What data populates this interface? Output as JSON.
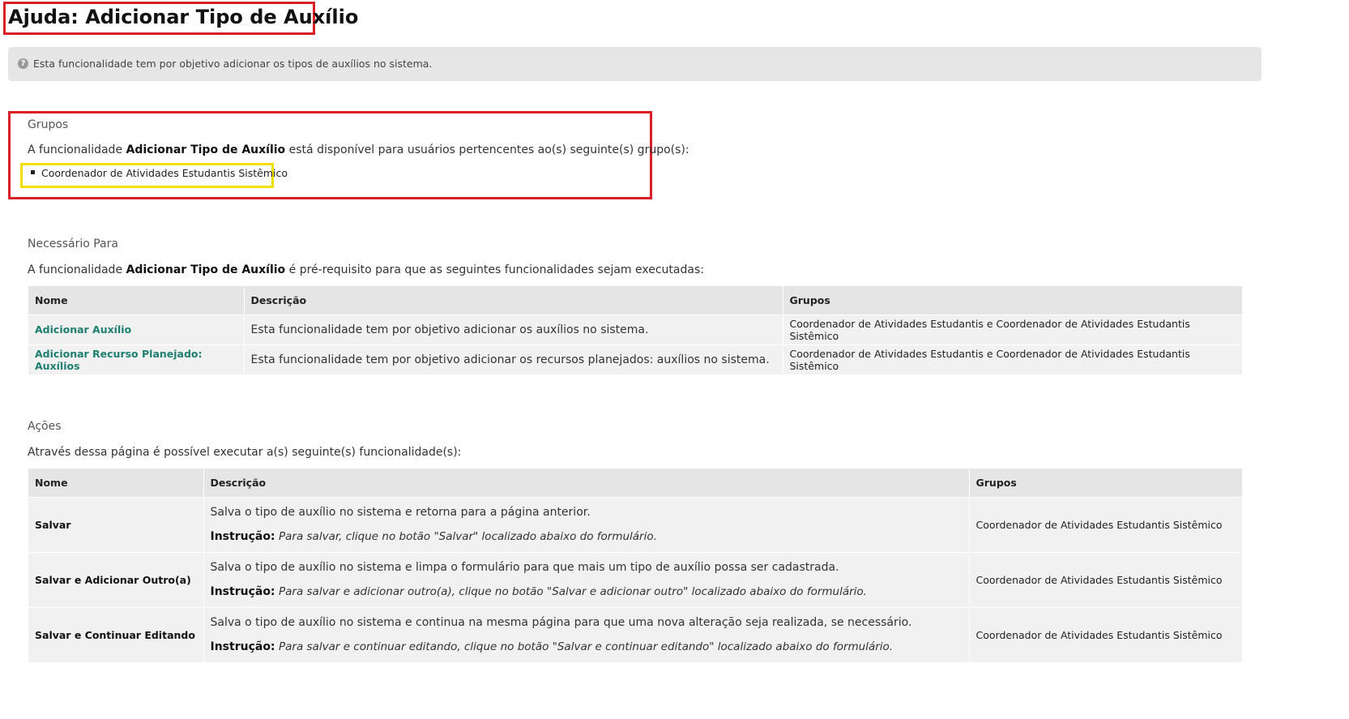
{
  "page": {
    "title": "Ajuda: Adicionar Tipo de Auxílio",
    "info": "Esta funcionalidade tem por objetivo adicionar os tipos de auxílios no sistema."
  },
  "groups": {
    "heading": "Grupos",
    "text_prefix": "A funcionalidade ",
    "text_bold": "Adicionar Tipo de Auxílio",
    "text_suffix": " está disponível para usuários pertencentes ao(s) seguinte(s) grupo(s):",
    "items": [
      "Coordenador de Atividades Estudantis Sistêmico"
    ]
  },
  "required_for": {
    "heading": "Necessário Para",
    "text_prefix": "A funcionalidade ",
    "text_bold": "Adicionar Tipo de Auxílio",
    "text_suffix": " é pré-requisito para que as seguintes funcionalidades sejam executadas:",
    "columns": [
      "Nome",
      "Descrição",
      "Grupos"
    ],
    "rows": [
      {
        "name": "Adicionar Auxílio",
        "description": "Esta funcionalidade tem por objetivo adicionar os auxílios no sistema.",
        "groups": "Coordenador de Atividades Estudantis e Coordenador de Atividades Estudantis Sistêmico"
      },
      {
        "name": "Adicionar Recurso Planejado: Auxílios",
        "description": "Esta funcionalidade tem por objetivo adicionar os recursos planejados: auxílios no sistema.",
        "groups": "Coordenador de Atividades Estudantis e Coordenador de Atividades Estudantis Sistêmico"
      }
    ]
  },
  "actions": {
    "heading": "Ações",
    "text": "Através dessa página é possível executar a(s) seguinte(s) funcionalidade(s):",
    "columns": [
      "Nome",
      "Descrição",
      "Grupos"
    ],
    "instruction_label": "Instrução:",
    "rows": [
      {
        "name": "Salvar",
        "description": "Salva o tipo de auxílio no sistema e retorna para a página anterior.",
        "instruction": "Para salvar, clique no botão \"Salvar\" localizado abaixo do formulário.",
        "groups": "Coordenador de Atividades Estudantis Sistêmico"
      },
      {
        "name": "Salvar e Adicionar Outro(a)",
        "description": "Salva o tipo de auxílio no sistema e limpa o formulário para que mais um tipo de auxílio possa ser cadastrada.",
        "instruction": "Para salvar e adicionar outro(a), clique no botão \"Salvar e adicionar outro\" localizado abaixo do formulário.",
        "groups": "Coordenador de Atividades Estudantis Sistêmico"
      },
      {
        "name": "Salvar e Continuar Editando",
        "description": "Salva o tipo de auxílio no sistema e continua na mesma página para que uma nova alteração seja realizada, se necessário.",
        "instruction": "Para salvar e continuar editando, clique no botão \"Salvar e continuar editando\" localizado abaixo do formulário.",
        "groups": "Coordenador de Atividades Estudantis Sistêmico"
      }
    ]
  }
}
